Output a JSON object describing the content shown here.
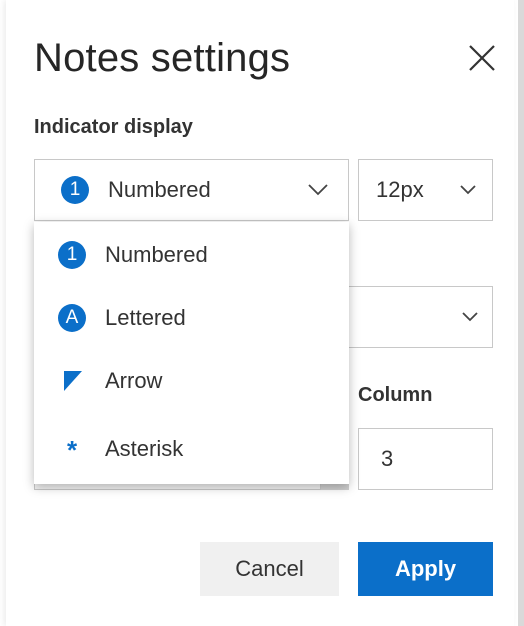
{
  "dialog": {
    "title": "Notes settings",
    "indicator_label": "Indicator display",
    "column_label": "Column"
  },
  "indicator_select": {
    "icon_text": "1",
    "value": "Numbered"
  },
  "size_select": {
    "value": "12px"
  },
  "dropdown": {
    "options": [
      {
        "icon": "1",
        "icon_name": "numbered-circle-icon",
        "label": "Numbered"
      },
      {
        "icon": "A",
        "icon_name": "lettered-circle-icon",
        "label": "Lettered"
      },
      {
        "icon": "",
        "icon_name": "arrow-triangle-icon",
        "label": "Arrow"
      },
      {
        "icon": "*",
        "icon_name": "asterisk-icon",
        "label": "Asterisk"
      }
    ]
  },
  "column_input": {
    "value": "3"
  },
  "buttons": {
    "cancel": "Cancel",
    "apply": "Apply"
  },
  "colors": {
    "accent": "#0b6fc9",
    "cancel_bg": "#f0f0f0",
    "border": "#c8c8c8"
  }
}
